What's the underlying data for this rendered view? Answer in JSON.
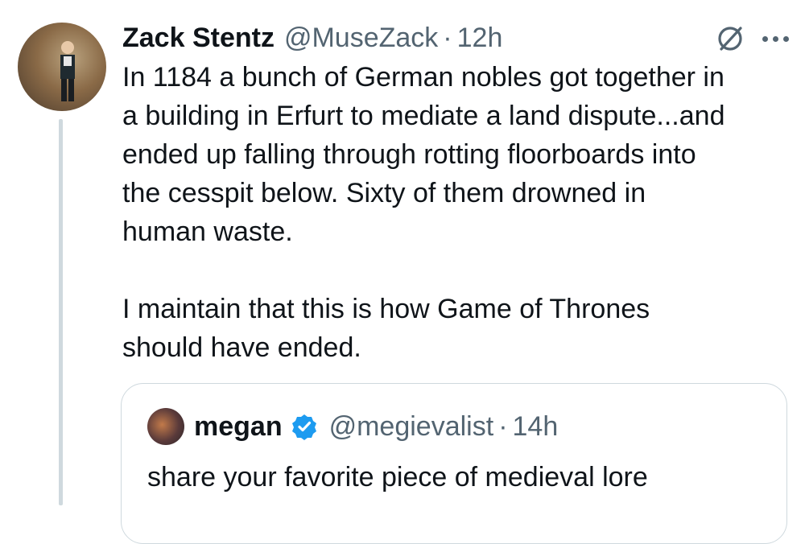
{
  "tweet": {
    "author_name": "Zack Stentz",
    "author_handle": "@MuseZack",
    "separator": "·",
    "time": "12h",
    "text": "In 1184 a bunch of German nobles got together in\na building in Erfurt to mediate a land dispute...and\nended up falling through rotting floorboards into\nthe cesspit below. Sixty of them drowned in\nhuman waste.\n\nI maintain that this is how Game of Thrones\nshould have ended.",
    "icons": [
      "avatar",
      "grok-icon",
      "more-options-icon"
    ]
  },
  "quoted_tweet": {
    "author_name": "megan",
    "author_handle": "@megievalist",
    "separator": "·",
    "time": "14h",
    "text": "share your favorite piece of medieval lore",
    "verified": true,
    "icons": [
      "avatar",
      "verified-badge-icon"
    ]
  },
  "colors": {
    "text": "#0f1419",
    "secondary": "#536471",
    "border": "#cfd9de",
    "verified": "#1d9bf0"
  }
}
